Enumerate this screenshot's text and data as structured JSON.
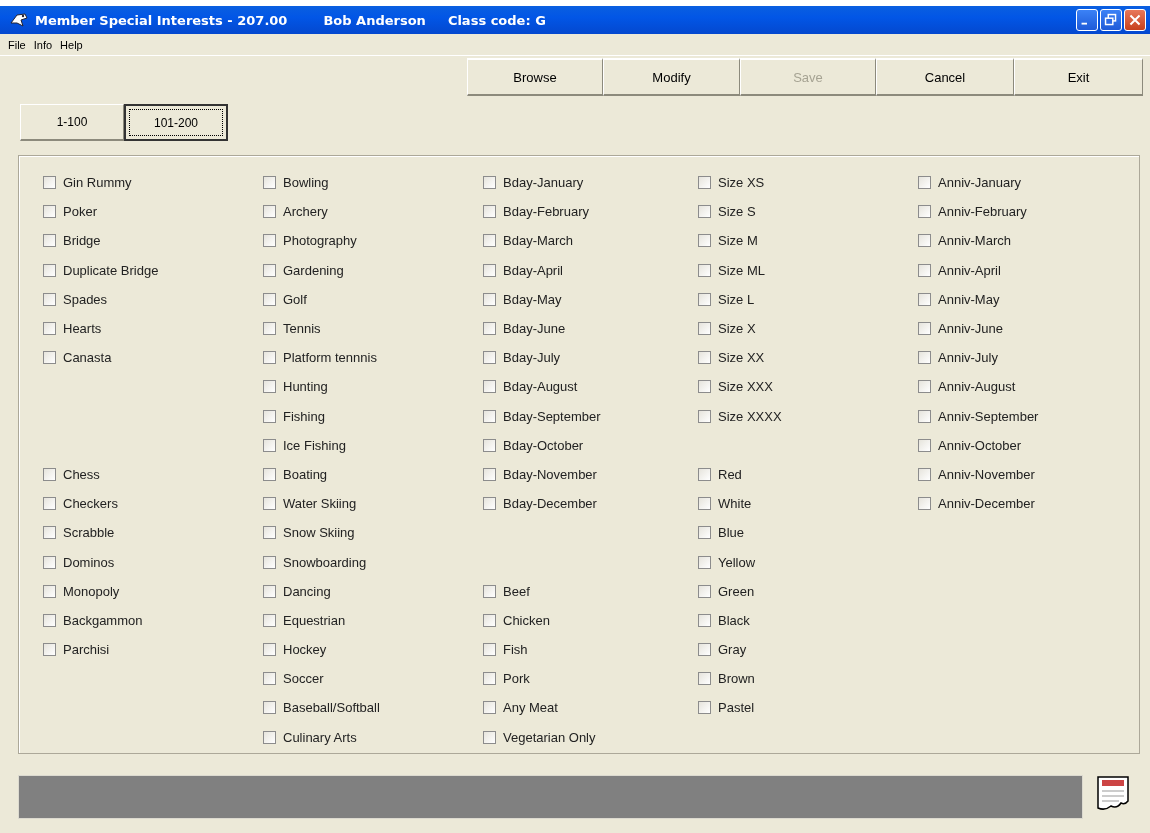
{
  "window": {
    "title": "Member Special Interests - 207.00",
    "member": "Bob Anderson",
    "class_code": "Class code:  G"
  },
  "menu": [
    {
      "label": "File"
    },
    {
      "label": "Info"
    },
    {
      "label": "Help"
    }
  ],
  "toolbar": [
    {
      "label": "Browse",
      "disabled": false
    },
    {
      "label": "Modify",
      "disabled": false
    },
    {
      "label": "Save",
      "disabled": true
    },
    {
      "label": "Cancel",
      "disabled": false
    },
    {
      "label": "Exit",
      "disabled": false
    }
  ],
  "tabs": [
    {
      "label": "1-100",
      "selected": false
    },
    {
      "label": "101-200",
      "selected": true
    }
  ],
  "columns": [
    [
      {
        "kind": "checkbox",
        "label": "Gin Rummy",
        "checked": false
      },
      {
        "kind": "checkbox",
        "label": "Poker",
        "checked": false
      },
      {
        "kind": "checkbox",
        "label": "Bridge",
        "checked": false
      },
      {
        "kind": "checkbox",
        "label": "Duplicate Bridge",
        "checked": false
      },
      {
        "kind": "checkbox",
        "label": "Spades",
        "checked": false
      },
      {
        "kind": "checkbox",
        "label": "Hearts",
        "checked": false
      },
      {
        "kind": "checkbox",
        "label": "Canasta",
        "checked": false
      },
      {
        "kind": "spacer"
      },
      {
        "kind": "spacer"
      },
      {
        "kind": "spacer"
      },
      {
        "kind": "checkbox",
        "label": "Chess",
        "checked": false
      },
      {
        "kind": "checkbox",
        "label": "Checkers",
        "checked": false
      },
      {
        "kind": "checkbox",
        "label": "Scrabble",
        "checked": false
      },
      {
        "kind": "checkbox",
        "label": "Dominos",
        "checked": false
      },
      {
        "kind": "checkbox",
        "label": "Monopoly",
        "checked": false
      },
      {
        "kind": "checkbox",
        "label": "Backgammon",
        "checked": false
      },
      {
        "kind": "checkbox",
        "label": "Parchisi",
        "checked": false
      }
    ],
    [
      {
        "kind": "checkbox",
        "label": "Bowling",
        "checked": false
      },
      {
        "kind": "checkbox",
        "label": "Archery",
        "checked": false
      },
      {
        "kind": "checkbox",
        "label": "Photography",
        "checked": false
      },
      {
        "kind": "checkbox",
        "label": "Gardening",
        "checked": false
      },
      {
        "kind": "checkbox",
        "label": "Golf",
        "checked": false
      },
      {
        "kind": "checkbox",
        "label": "Tennis",
        "checked": false
      },
      {
        "kind": "checkbox",
        "label": "Platform tennnis",
        "checked": false
      },
      {
        "kind": "checkbox",
        "label": "Hunting",
        "checked": false
      },
      {
        "kind": "checkbox",
        "label": "Fishing",
        "checked": false
      },
      {
        "kind": "checkbox",
        "label": "Ice Fishing",
        "checked": false
      },
      {
        "kind": "checkbox",
        "label": "Boating",
        "checked": false
      },
      {
        "kind": "checkbox",
        "label": "Water Skiing",
        "checked": false
      },
      {
        "kind": "checkbox",
        "label": "Snow Skiing",
        "checked": false
      },
      {
        "kind": "checkbox",
        "label": "Snowboarding",
        "checked": false
      },
      {
        "kind": "checkbox",
        "label": "Dancing",
        "checked": false
      },
      {
        "kind": "checkbox",
        "label": "Equestrian",
        "checked": false
      },
      {
        "kind": "checkbox",
        "label": "Hockey",
        "checked": false
      },
      {
        "kind": "checkbox",
        "label": "Soccer",
        "checked": false
      },
      {
        "kind": "checkbox",
        "label": "Baseball/Softball",
        "checked": false
      },
      {
        "kind": "checkbox",
        "label": "Culinary Arts",
        "checked": false
      }
    ],
    [
      {
        "kind": "checkbox",
        "label": "Bday-January",
        "checked": false
      },
      {
        "kind": "checkbox",
        "label": "Bday-February",
        "checked": false
      },
      {
        "kind": "checkbox",
        "label": "Bday-March",
        "checked": false
      },
      {
        "kind": "checkbox",
        "label": "Bday-April",
        "checked": false
      },
      {
        "kind": "checkbox",
        "label": "Bday-May",
        "checked": false
      },
      {
        "kind": "checkbox",
        "label": "Bday-June",
        "checked": false
      },
      {
        "kind": "checkbox",
        "label": "Bday-July",
        "checked": false
      },
      {
        "kind": "checkbox",
        "label": "Bday-August",
        "checked": false
      },
      {
        "kind": "checkbox",
        "label": "Bday-September",
        "checked": false
      },
      {
        "kind": "checkbox",
        "label": "Bday-October",
        "checked": false
      },
      {
        "kind": "checkbox",
        "label": "Bday-November",
        "checked": false
      },
      {
        "kind": "checkbox",
        "label": "Bday-December",
        "checked": false
      },
      {
        "kind": "spacer"
      },
      {
        "kind": "spacer"
      },
      {
        "kind": "checkbox",
        "label": "Beef",
        "checked": false
      },
      {
        "kind": "checkbox",
        "label": "Chicken",
        "checked": false
      },
      {
        "kind": "checkbox",
        "label": "Fish",
        "checked": false
      },
      {
        "kind": "checkbox",
        "label": "Pork",
        "checked": false
      },
      {
        "kind": "checkbox",
        "label": "Any Meat",
        "checked": false
      },
      {
        "kind": "checkbox",
        "label": "Vegetarian Only",
        "checked": false
      }
    ],
    [
      {
        "kind": "checkbox",
        "label": "Size XS",
        "checked": false
      },
      {
        "kind": "checkbox",
        "label": "Size S",
        "checked": false
      },
      {
        "kind": "checkbox",
        "label": "Size M",
        "checked": false
      },
      {
        "kind": "checkbox",
        "label": "Size ML",
        "checked": false
      },
      {
        "kind": "checkbox",
        "label": "Size L",
        "checked": false
      },
      {
        "kind": "checkbox",
        "label": "Size X",
        "checked": false
      },
      {
        "kind": "checkbox",
        "label": "Size XX",
        "checked": false
      },
      {
        "kind": "checkbox",
        "label": "Size XXX",
        "checked": false
      },
      {
        "kind": "checkbox",
        "label": "Size XXXX",
        "checked": false
      },
      {
        "kind": "spacer"
      },
      {
        "kind": "checkbox",
        "label": "Red",
        "checked": false
      },
      {
        "kind": "checkbox",
        "label": "White",
        "checked": false
      },
      {
        "kind": "checkbox",
        "label": "Blue",
        "checked": false
      },
      {
        "kind": "checkbox",
        "label": "Yellow",
        "checked": false
      },
      {
        "kind": "checkbox",
        "label": "Green",
        "checked": false
      },
      {
        "kind": "checkbox",
        "label": "Black",
        "checked": false
      },
      {
        "kind": "checkbox",
        "label": "Gray",
        "checked": false
      },
      {
        "kind": "checkbox",
        "label": "Brown",
        "checked": false
      },
      {
        "kind": "checkbox",
        "label": "Pastel",
        "checked": false
      }
    ],
    [
      {
        "kind": "checkbox",
        "label": "Anniv-January",
        "checked": false
      },
      {
        "kind": "checkbox",
        "label": "Anniv-February",
        "checked": false
      },
      {
        "kind": "checkbox",
        "label": "Anniv-March",
        "checked": false
      },
      {
        "kind": "checkbox",
        "label": "Anniv-April",
        "checked": false
      },
      {
        "kind": "checkbox",
        "label": "Anniv-May",
        "checked": false
      },
      {
        "kind": "checkbox",
        "label": "Anniv-June",
        "checked": false
      },
      {
        "kind": "checkbox",
        "label": "Anniv-July",
        "checked": false
      },
      {
        "kind": "checkbox",
        "label": "Anniv-August",
        "checked": false
      },
      {
        "kind": "checkbox",
        "label": "Anniv-September",
        "checked": false
      },
      {
        "kind": "checkbox",
        "label": "Anniv-October",
        "checked": false
      },
      {
        "kind": "checkbox",
        "label": "Anniv-November",
        "checked": false
      },
      {
        "kind": "checkbox",
        "label": "Anniv-December",
        "checked": false
      }
    ]
  ]
}
